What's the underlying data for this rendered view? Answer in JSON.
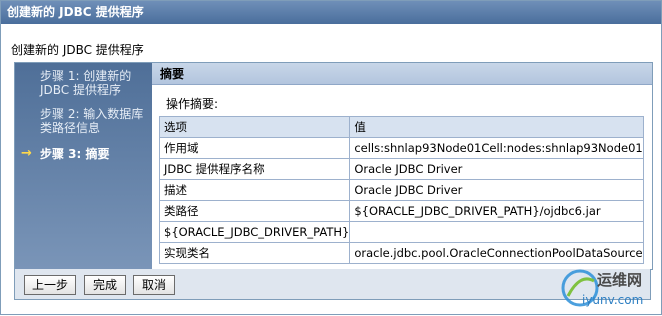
{
  "window": {
    "title": "创建新的 JDBC 提供程序"
  },
  "subtitle": "创建新的 JDBC 提供程序",
  "steps": [
    {
      "label": "步骤 1: 创建新的 JDBC 提供程序",
      "current": false
    },
    {
      "label": "步骤 2: 输入数据库类路径信息",
      "current": false
    },
    {
      "label": "步骤 3: 摘要",
      "current": true
    }
  ],
  "current_arrow": "→",
  "panel": {
    "title": "摘要",
    "op_summary": "操作摘要:",
    "table": {
      "headers": [
        "选项",
        "值"
      ],
      "rows": [
        [
          "作用域",
          "cells:shnlap93Node01Cell:nodes:shnlap93Node01"
        ],
        [
          "JDBC 提供程序名称",
          "Oracle JDBC Driver"
        ],
        [
          "描述",
          "Oracle JDBC Driver"
        ],
        [
          "类路径",
          "${ORACLE_JDBC_DRIVER_PATH}/ojdbc6.jar"
        ],
        [
          "${ORACLE_JDBC_DRIVER_PATH}",
          ""
        ],
        [
          "实现类名",
          "oracle.jdbc.pool.OracleConnectionPoolDataSource"
        ]
      ]
    }
  },
  "buttons": {
    "prev": "上一步",
    "finish": "完成",
    "cancel": "取消"
  },
  "watermark": {
    "line1": "运维网",
    "line2": "iyunv.com"
  }
}
